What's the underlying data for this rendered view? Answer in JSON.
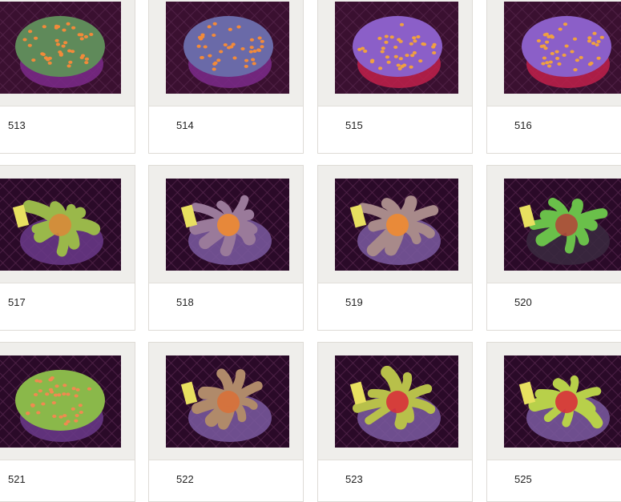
{
  "gallery": {
    "items": [
      {
        "label": "513",
        "palette": {
          "bg": "#3a1030",
          "body": "#5f8a5a",
          "spots": "#f28a3a",
          "accent": "#7b2a8a"
        },
        "kind": "spotted"
      },
      {
        "label": "514",
        "palette": {
          "bg": "#3a1030",
          "body": "#6a6aa8",
          "spots": "#f28a3a",
          "accent": "#7b2a8a"
        },
        "kind": "spotted"
      },
      {
        "label": "515",
        "palette": {
          "bg": "#3a1030",
          "body": "#8b5fc8",
          "spots": "#f0a040",
          "accent": "#c0204a"
        },
        "kind": "spotted"
      },
      {
        "label": "516",
        "palette": {
          "bg": "#3a1030",
          "body": "#8b5fc8",
          "spots": "#f0a040",
          "accent": "#c0204a"
        },
        "kind": "spotted"
      },
      {
        "label": "517",
        "palette": {
          "bg": "#2a0a28",
          "body": "#9ab84a",
          "spots": "#d88a3a",
          "accent": "#6a3a8a"
        },
        "kind": "frond"
      },
      {
        "label": "518",
        "palette": {
          "bg": "#2a0a28",
          "body": "#9a7a9a",
          "spots": "#f08a30",
          "accent": "#7a5aa0"
        },
        "kind": "frond"
      },
      {
        "label": "519",
        "palette": {
          "bg": "#2a0a28",
          "body": "#a88a8a",
          "spots": "#f08a30",
          "accent": "#7a5aa0"
        },
        "kind": "frond"
      },
      {
        "label": "520",
        "palette": {
          "bg": "#2a0a28",
          "body": "#6ac04a",
          "spots": "#b04a3a",
          "accent": "#3a2a40"
        },
        "kind": "frond"
      },
      {
        "label": "521",
        "palette": {
          "bg": "#2a0a28",
          "body": "#8ab84a",
          "spots": "#f08a50",
          "accent": "#6a3a8a"
        },
        "kind": "spotted"
      },
      {
        "label": "522",
        "palette": {
          "bg": "#2a0a28",
          "body": "#b08a6a",
          "spots": "#d8703a",
          "accent": "#7a5aa0"
        },
        "kind": "frond"
      },
      {
        "label": "523",
        "palette": {
          "bg": "#2a0a28",
          "body": "#b8c04a",
          "spots": "#d8303a",
          "accent": "#7a5aa0"
        },
        "kind": "frond"
      },
      {
        "label": "525",
        "palette": {
          "bg": "#2a0a28",
          "body": "#b8d04a",
          "spots": "#d8303a",
          "accent": "#7a5aa0"
        },
        "kind": "frond"
      }
    ]
  }
}
